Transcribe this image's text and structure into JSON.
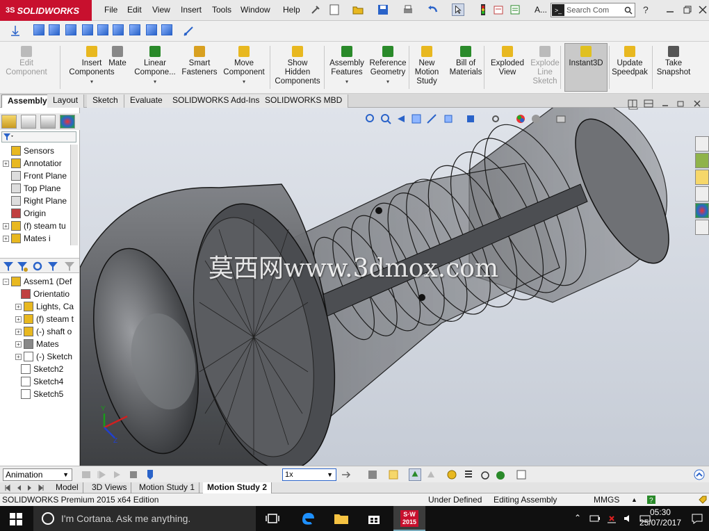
{
  "app": {
    "logo_prefix": "3S",
    "logo_text": "SOLIDWORKS"
  },
  "menu": [
    "File",
    "Edit",
    "View",
    "Insert",
    "Tools",
    "Window",
    "Help"
  ],
  "search": {
    "placeholder": "Search Com",
    "cmd_icon": ">_"
  },
  "toolbar_label_a": "A...",
  "command_manager": [
    {
      "label": "Edit\nComponent",
      "icon": "edit-component-icon",
      "disabled": true
    },
    {
      "label": "Insert\nComponents",
      "icon": "insert-components-icon",
      "disabled": false,
      "arrow": true
    },
    {
      "label": "Mate",
      "icon": "mate-icon",
      "disabled": false
    },
    {
      "label": "Linear\nCompone...",
      "icon": "linear-pattern-icon",
      "disabled": false,
      "arrow": true
    },
    {
      "label": "Smart\nFasteners",
      "icon": "smart-fasteners-icon",
      "disabled": false
    },
    {
      "label": "Move\nComponent",
      "icon": "move-component-icon",
      "disabled": false,
      "arrow": true
    },
    {
      "label": "Show\nHidden\nComponents",
      "icon": "show-hidden-icon",
      "disabled": false
    },
    {
      "label": "Assembly\nFeatures",
      "icon": "assembly-features-icon",
      "disabled": false,
      "arrow": true
    },
    {
      "label": "Reference\nGeometry",
      "icon": "reference-geometry-icon",
      "disabled": false,
      "arrow": true
    },
    {
      "label": "New\nMotion\nStudy",
      "icon": "new-motion-study-icon",
      "disabled": false
    },
    {
      "label": "Bill of\nMaterials",
      "icon": "bill-of-materials-icon",
      "disabled": false
    },
    {
      "label": "Exploded\nView",
      "icon": "exploded-view-icon",
      "disabled": false
    },
    {
      "label": "Explode\nLine\nSketch",
      "icon": "explode-line-sketch-icon",
      "disabled": true
    },
    {
      "label": "Instant3D",
      "icon": "instant3d-icon",
      "disabled": false,
      "active": true
    },
    {
      "label": "Update\nSpeedpak",
      "icon": "update-speedpak-icon",
      "disabled": false
    },
    {
      "label": "Take\nSnapshot",
      "icon": "take-snapshot-icon",
      "disabled": false
    }
  ],
  "tabs": [
    "Assembly",
    "Layout",
    "Sketch",
    "Evaluate",
    "SOLIDWORKS Add-Ins",
    "SOLIDWORKS MBD"
  ],
  "tree_top": [
    "Sensors",
    "Annotatior",
    "Front Plane",
    "Top Plane",
    "Right Plane",
    "Origin",
    "(f) steam tu",
    "Mates i"
  ],
  "tree_bottom": [
    "Assem1  (Def",
    "Orientatio",
    "Lights, Ca",
    "(f) steam t",
    "(-) shaft o",
    "Mates",
    "(-) Sketch",
    "Sketch2",
    "Sketch4",
    "Sketch5"
  ],
  "watermark": "莫西网www.3dmox.com",
  "animation": {
    "mode": "Animation",
    "speed": "1x"
  },
  "bottom_tabs": [
    "Model",
    "3D Views",
    "Motion Study 1",
    "Motion Study 2"
  ],
  "status": {
    "edition": "SOLIDWORKS Premium 2015 x64 Edition",
    "state": "Under Defined",
    "mode": "Editing Assembly",
    "units": "MMGS"
  },
  "taskbar": {
    "cortana": "I'm Cortana. Ask me anything.",
    "time": "05:30",
    "date": "25/07/2017",
    "sw_badge": "2015"
  },
  "colors": {
    "accent": "#2a63c9",
    "logo_red": "#c8102e",
    "viewport_top": "#dfe3ea",
    "viewport_bottom": "#c6ccd6"
  }
}
